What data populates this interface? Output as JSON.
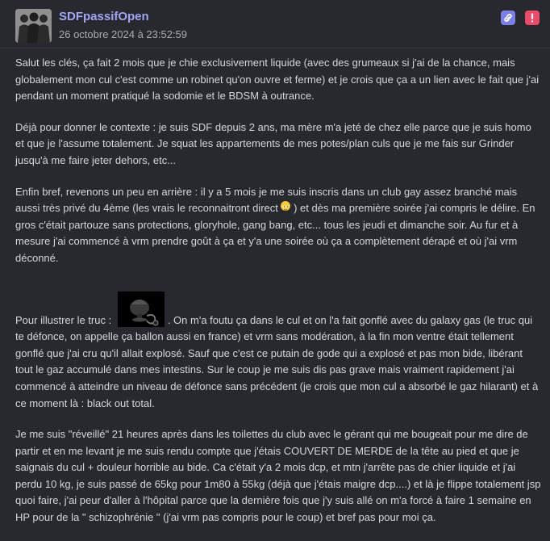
{
  "post": {
    "username": "SDFpassifOpen",
    "timestamp": "26 octobre 2024 à 23:52:59",
    "avatar_icon": "group-silhouette-icon",
    "actions": [
      {
        "icon": "link-icon",
        "color": "#7b7fe8"
      },
      {
        "icon": "alert-icon",
        "color": "#ec4b6a"
      }
    ]
  },
  "body": {
    "p1": "Salut les clés, ça fait 2 mois que je chie exclusivement liquide (avec des grumeaux si j'ai de la chance, mais globalement mon cul c'est comme un robinet qu'on ouvre et ferme) et je crois que ça a un lien avec le fait que j'ai pendant un moment pratiqué la sodomie et le BDSM à outrance.",
    "p2": "Déjà pour donner le contexte : je suis SDF depuis 2 ans, ma mère m'a jeté de chez elle parce que je suis homo et que je l'assume totalement. Je squat les appartements de mes potes/plan culs que je me fais sur Grinder jusqu'à me faire jeter dehors, etc...",
    "p3_before": "Enfin bref, revenons un peu en arrière : il y a 5 mois je me suis inscris dans un club gay assez branché mais aussi très privé du 4ème (les vrais le reconnaitront direct ",
    "p3_after": " ) et dès ma première soirée j'ai compris le délire. En gros c'était partouze sans protections, gloryhole, gang bang, etc... tous les jeudi et dimanche soir. Au fur et à mesure j'ai commencé à vrm prendre goût à ça et y'a une soirée où ça a complètement dérapé et où j'ai vrm déconné.",
    "p4_before": "Pour illustrer le truc : ",
    "p4_after": ". On m'a foutu ça dans le cul et on l'a fait gonflé avec du galaxy gas (le truc qui te défonce, on appelle ça ballon aussi en france) et vrm sans modération, à la fin mon ventre était tellement gonflé que j'ai cru qu'il allait explosé. Sauf que c'est ce putain de gode qui a explosé et pas mon bide, libérant tout le gaz accumulé dans mes intestins. Sur le coup je me suis dis pas grave mais vraiment rapidement j'ai commencé à atteindre un niveau de défonce sans précédent (je crois que mon cul a absorbé le gaz hilarant) et à ce moment là : black out total.",
    "p5": "Je me suis \"réveillé\" 21 heures après dans les toilettes du club avec le gérant qui me bougeait pour me dire de partir et en me levant je me suis rendu compte que j'étais COUVERT DE MERDE de la tête au pied et que je saignais du cul + douleur horrible au bide. Ca c'était y'a 2 mois dcp, et mtn j'arrête pas de chier liquide et j'ai perdu 10 kg, je suis passé de 65kg pour 1m80 à 55kg (déjà que j'étais maigre dcp....) et là je flippe totalement jsp quoi faire, j'ai peur d'aller à l'hôpital parce que la dernière fois que j'y suis allé on m'a forcé à faire 1 semaine en HP pour de la \" schizophrénie \" (j'ai vrm pas compris pour le coup) et bref pas pour moi ça."
  }
}
